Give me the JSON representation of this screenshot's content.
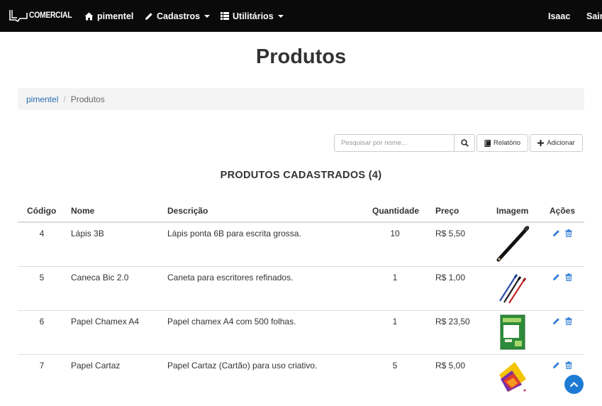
{
  "navbar": {
    "brand": "COMERCIAL",
    "home": "pimentel",
    "cadastros": "Cadastros",
    "utilitarios": "Utilitários",
    "user": "Isaac",
    "logout": "Sair"
  },
  "page": {
    "title": "Produtos"
  },
  "breadcrumb": {
    "home": "pimentel",
    "current": "Produtos"
  },
  "toolbar": {
    "search_placeholder": "Pesquisar por nome...",
    "report_label": "Relatório",
    "add_label": "Adicionar"
  },
  "table": {
    "caption": "PRODUTOS CADASTRADOS (4)",
    "headers": {
      "codigo": "Código",
      "nome": "Nome",
      "descricao": "Descrição",
      "quantidade": "Quantidade",
      "preco": "Preço",
      "imagem": "Imagem",
      "acoes": "Ações"
    },
    "rows": [
      {
        "codigo": "4",
        "nome": "Lápis 3B",
        "descricao": "Lápis ponta 6B para escrita grossa.",
        "quantidade": "10",
        "preco": "R$ 5,50"
      },
      {
        "codigo": "5",
        "nome": "Caneca Bic 2.0",
        "descricao": "Caneta para escritores refinados.",
        "quantidade": "1",
        "preco": "R$ 1,00"
      },
      {
        "codigo": "6",
        "nome": "Papel Chamex A4",
        "descricao": "Papel chamex A4 com 500 folhas.",
        "quantidade": "1",
        "preco": "R$ 23,50"
      },
      {
        "codigo": "7",
        "nome": "Papel Cartaz",
        "descricao": "Papel Cartaz (Cartão) para uso criativo.",
        "quantidade": "5",
        "preco": "R$ 5,00"
      }
    ]
  },
  "colors": {
    "navbar_bg": "#0a0a0a",
    "link": "#2a6fb0",
    "action_icon": "#2a7ad4",
    "scroll_button": "#1e7bd3"
  },
  "icons": [
    "logo-icon",
    "home-icon",
    "pencil-icon",
    "grid-icon",
    "search-icon",
    "book-icon",
    "plus-icon",
    "edit-icon",
    "trash-icon",
    "chevron-up-icon"
  ]
}
